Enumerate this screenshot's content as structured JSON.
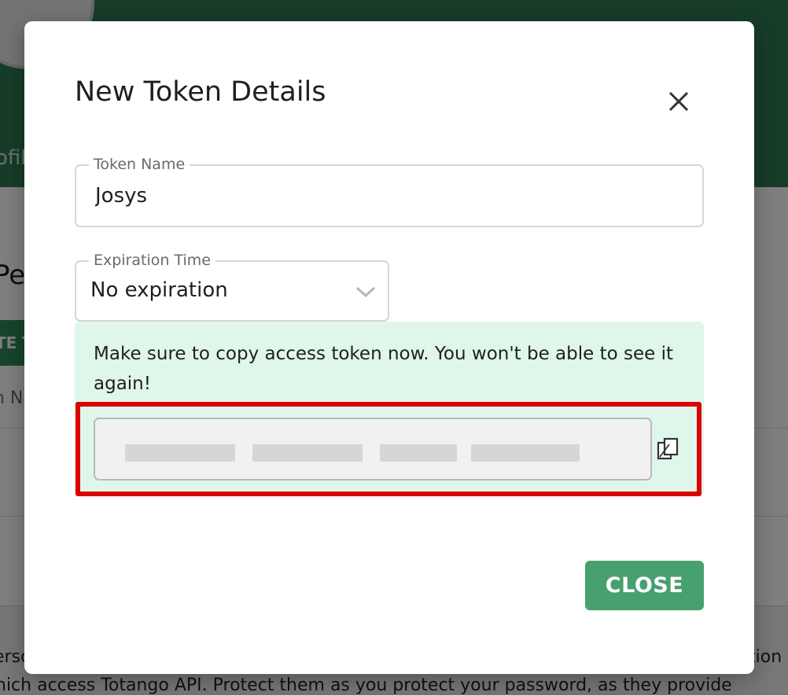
{
  "background": {
    "profile_tab_label": "ofile",
    "page_heading": "Per",
    "create_button_label": "TE T",
    "column_header": "n Na",
    "desc_line1_left": "ersc",
    "desc_line1_right": "tion",
    "desc_line2": "hich access Totango API. Protect them as you protect your password, as they provide"
  },
  "modal": {
    "title": "New Token Details",
    "token_name_label": "Token Name",
    "token_name_value": "Josys",
    "expiration_label": "Expiration Time",
    "expiration_value": "No expiration",
    "notice_text": "Make sure to copy access token now. You won't be able to see it again!",
    "close_button_label": "CLOSE"
  },
  "colors": {
    "header_green": "#2f7a52",
    "notice_bg": "#dff7ea",
    "highlight_red": "#dc0000",
    "button_green": "#47a06f"
  },
  "icons": [
    "close-icon",
    "chevron-down-icon",
    "copy-icon"
  ]
}
